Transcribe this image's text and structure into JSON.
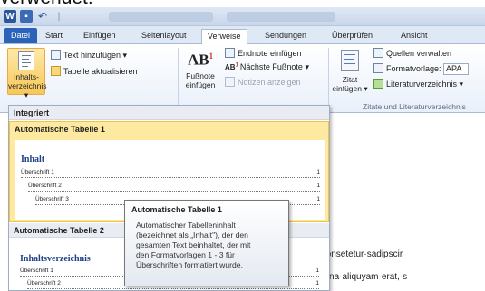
{
  "caption": "verwendet:",
  "titlebar": {
    "qat": {
      "word_icon": "W",
      "undo_icon": "↶",
      "separator": "|"
    }
  },
  "tabs": [
    "Datei",
    "Start",
    "Einfügen",
    "Seitenlayout",
    "Verweise",
    "Sendungen",
    "Überprüfen",
    "Ansicht"
  ],
  "active_tab": "Verweise",
  "ribbon": {
    "toc_button": {
      "line1": "Inhalts-",
      "line2": "verzeichnis ▾"
    },
    "text_add": "Text hinzufügen ▾",
    "table_update": "Tabelle aktualisieren",
    "footnote_button": {
      "glyph": "AB",
      "sup": "1",
      "line1": "Fußnote",
      "line2": "einfügen"
    },
    "endnote_insert": "Endnote einfügen",
    "next_footnote": "Nächste Fußnote ▾",
    "show_notes": "Notizen anzeigen",
    "citation_button": {
      "line1": "Zitat",
      "line2": "einfügen ▾"
    },
    "manage_sources": "Quellen verwalten",
    "format_template_label": "Formatvorlage:",
    "format_template_value": "APA",
    "bibliography": "Literaturverzeichnis ▾",
    "group_label_citations": "Zitate und Literaturverzeichnis",
    "next_footnote_icon_text": "AB",
    "next_footnote_icon_sup": "1"
  },
  "document": {
    "heading_fragment": "t¶",
    "line1": "it·amet,·consetetur·sadipscir",
    "line2": "olore·magna·aliquyam·erat,·s"
  },
  "gallery": {
    "section_builtin": "Integriert",
    "item1": {
      "title": "Automatische Tabelle 1",
      "preview_heading": "Inhalt",
      "entries": [
        {
          "text": "Überschrift 1",
          "page": "1"
        },
        {
          "text": "Überschrift 2",
          "page": "1"
        },
        {
          "text": "Überschrift 3",
          "page": "1"
        }
      ]
    },
    "item2": {
      "title": "Automatische Tabelle 2",
      "preview_heading": "Inhaltsverzeichnis",
      "entries": [
        {
          "text": "Überschrift 1",
          "page": "1"
        },
        {
          "text": "Überschrift 2",
          "page": "1"
        }
      ]
    }
  },
  "tooltip": {
    "title": "Automatische Tabelle 1",
    "body": [
      "Automatischer Tabelleninhalt",
      "(bezeichnet als „Inhalt\"), der den",
      "gesamten Text beinhaltet, der mit",
      "den Formatvorlagen 1 - 3 für",
      "Überschriften formatiert wurde."
    ]
  },
  "colors": {
    "accent": "#2b63b8",
    "highlight": "#fde9a0",
    "heading": "#1d3f8a"
  }
}
